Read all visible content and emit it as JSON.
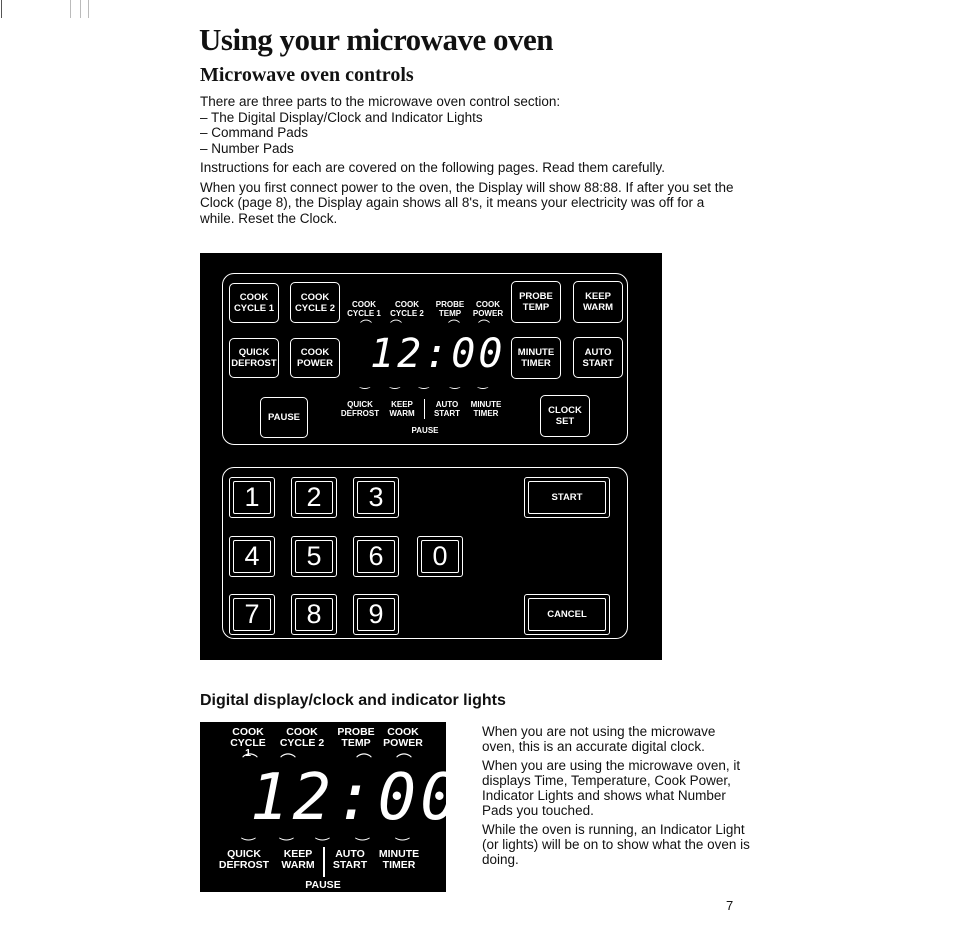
{
  "title": "Using your microwave oven",
  "subtitle": "Microwave oven controls",
  "intro": [
    "There are three parts to the microwave oven control section:",
    "– The Digital Display/Clock and Indicator Lights",
    "– Command Pads",
    "– Number Pads",
    "Instructions for each are covered on the following pages. Read them carefully.",
    "When you first connect power to the oven, the Display will show 88:88. If after you set the Clock (page 8), the Display again shows all 8's, it means your electricity was off for a while. Reset the Clock."
  ],
  "control_panel": {
    "buttons": {
      "cook_cycle_1": [
        "COOK",
        "CYCLE 1"
      ],
      "cook_cycle_2": [
        "COOK",
        "CYCLE 2"
      ],
      "quick_defrost": [
        "QUICK",
        "DEFROST"
      ],
      "cook_power": [
        "COOK",
        "POWER"
      ],
      "pause": "PAUSE",
      "probe_temp": [
        "PROBE",
        "TEMP"
      ],
      "keep_warm": [
        "KEEP",
        "WARM"
      ],
      "minute_timer": [
        "MINUTE",
        "TIMER"
      ],
      "auto_start": [
        "AUTO",
        "START"
      ],
      "clock_set": [
        "CLOCK",
        "SET"
      ]
    },
    "display": {
      "top_labels": [
        [
          "COOK",
          "CYCLE 1"
        ],
        [
          "COOK",
          "CYCLE 2"
        ],
        [
          "PROBE",
          "TEMP"
        ],
        [
          "COOK",
          "POWER"
        ]
      ],
      "time": "12:00",
      "bottom_labels": [
        [
          "QUICK",
          "DEFROST"
        ],
        [
          "KEEP",
          "WARM"
        ],
        [
          "AUTO",
          "START"
        ],
        [
          "MINUTE",
          "TIMER"
        ]
      ],
      "pause_label": "PAUSE"
    },
    "number_pads": [
      "1",
      "2",
      "3",
      "4",
      "5",
      "6",
      "0",
      "7",
      "8",
      "9"
    ],
    "start": "START",
    "cancel": "CANCEL"
  },
  "section_heading": "Digital display/clock and indicator lights",
  "description": [
    "When you are not using the microwave oven, this is an accurate digital clock.",
    "When you are using the microwave oven, it displays Time, Temperature, Cook Power, Indicator Lights and shows what Number Pads you touched.",
    "While the oven is running, an Indicator Light (or lights) will be on to show what the oven is doing."
  ],
  "page_number": "7"
}
